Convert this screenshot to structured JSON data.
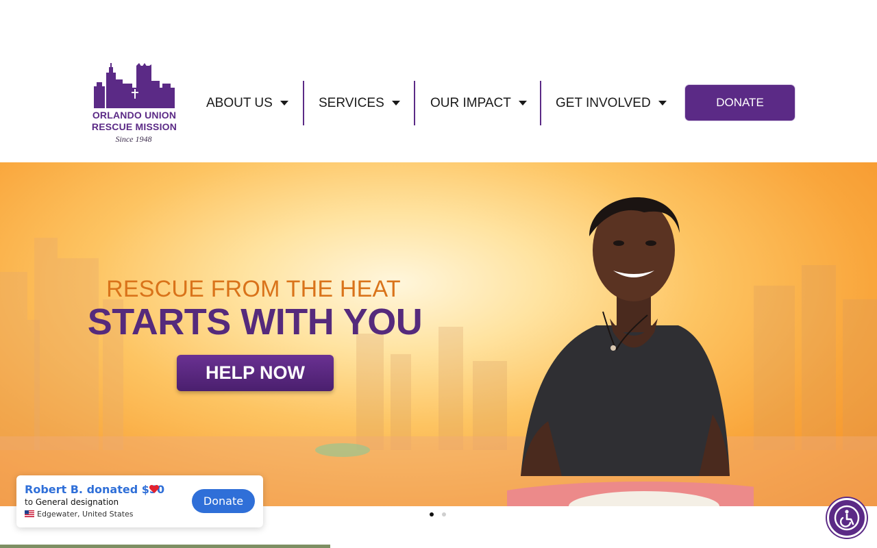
{
  "logo": {
    "line1": "ORLANDO UNION",
    "line2": "RESCUE  MISSION",
    "since": "Since 1948"
  },
  "nav": {
    "items": [
      {
        "label": "ABOUT US"
      },
      {
        "label": "SERVICES"
      },
      {
        "label": "OUR IMPACT"
      },
      {
        "label": "GET INVOLVED"
      }
    ],
    "donate_label": "DONATE"
  },
  "hero": {
    "line1": "RESCUE FROM THE HEAT",
    "line2": "STARTS WITH YOU",
    "cta_label": "HELP NOW"
  },
  "slider": {
    "active_slide": 1,
    "total_slides": 2
  },
  "notification": {
    "title": "Robert B. donated $50",
    "to_prefix": "to",
    "designation": "General designation",
    "location": "Edgewater, United States",
    "button_label": "Donate"
  },
  "colors": {
    "brand_purple": "#5b2a86",
    "hero_orange": "#f38b22",
    "hero_text_orange": "#d9731a",
    "notif_blue": "#2f6fd8"
  },
  "icons": {
    "nav_caret": "caret-down-icon",
    "heart": "heart-icon",
    "flag": "us-flag-icon",
    "accessibility": "accessibility-icon"
  }
}
